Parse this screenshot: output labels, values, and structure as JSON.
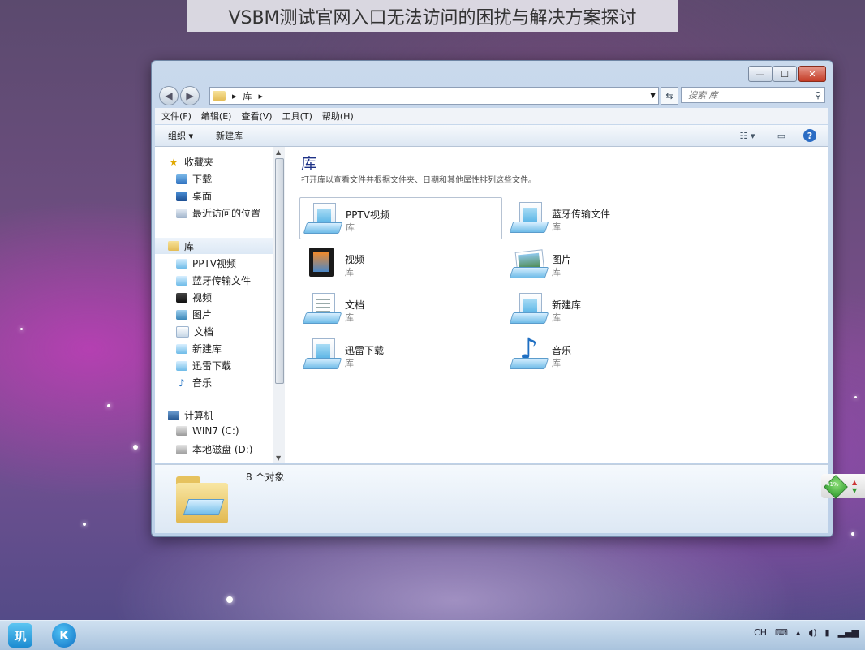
{
  "caption": "VSBM测试官网入口无法访问的困扰与解决方案探讨",
  "window": {
    "caption_buttons": {
      "minimize": "—",
      "maximize": "☐",
      "close": "✕"
    },
    "address": {
      "segments": [
        "库"
      ],
      "separator": "▸"
    },
    "search_placeholder": "搜索 库",
    "menu": [
      "文件(F)",
      "编辑(E)",
      "查看(V)",
      "工具(T)",
      "帮助(H)"
    ],
    "toolbar": {
      "organize": "组织 ▾",
      "new_library": "新建库"
    }
  },
  "nav_pane": {
    "favorites": {
      "label": "收藏夹",
      "items": [
        "下载",
        "桌面",
        "最近访问的位置"
      ]
    },
    "libraries": {
      "label": "库",
      "items": [
        "PPTV视频",
        "蓝牙传输文件",
        "视频",
        "图片",
        "文档",
        "新建库",
        "迅雷下载",
        "音乐"
      ]
    },
    "computer": {
      "label": "计算机",
      "items": [
        "WIN7 (C:)",
        "本地磁盘 (D:)"
      ]
    }
  },
  "content": {
    "title": "库",
    "description": "打开库以查看文件并根据文件夹、日期和其他属性排列这些文件。",
    "libraries": [
      {
        "name": "PPTV视频",
        "kind": "库"
      },
      {
        "name": "蓝牙传输文件",
        "kind": "库"
      },
      {
        "name": "视频",
        "kind": "库"
      },
      {
        "name": "图片",
        "kind": "库"
      },
      {
        "name": "文档",
        "kind": "库"
      },
      {
        "name": "新建库",
        "kind": "库"
      },
      {
        "name": "迅雷下载",
        "kind": "库"
      },
      {
        "name": "音乐",
        "kind": "库"
      }
    ]
  },
  "status": {
    "count": "8 个对象"
  },
  "gadget": {
    "percent": "41%"
  },
  "taskbar": {
    "lang": "CH"
  },
  "colors": {
    "title_blue": "#1e3287",
    "accent": "#2b6cc4"
  }
}
